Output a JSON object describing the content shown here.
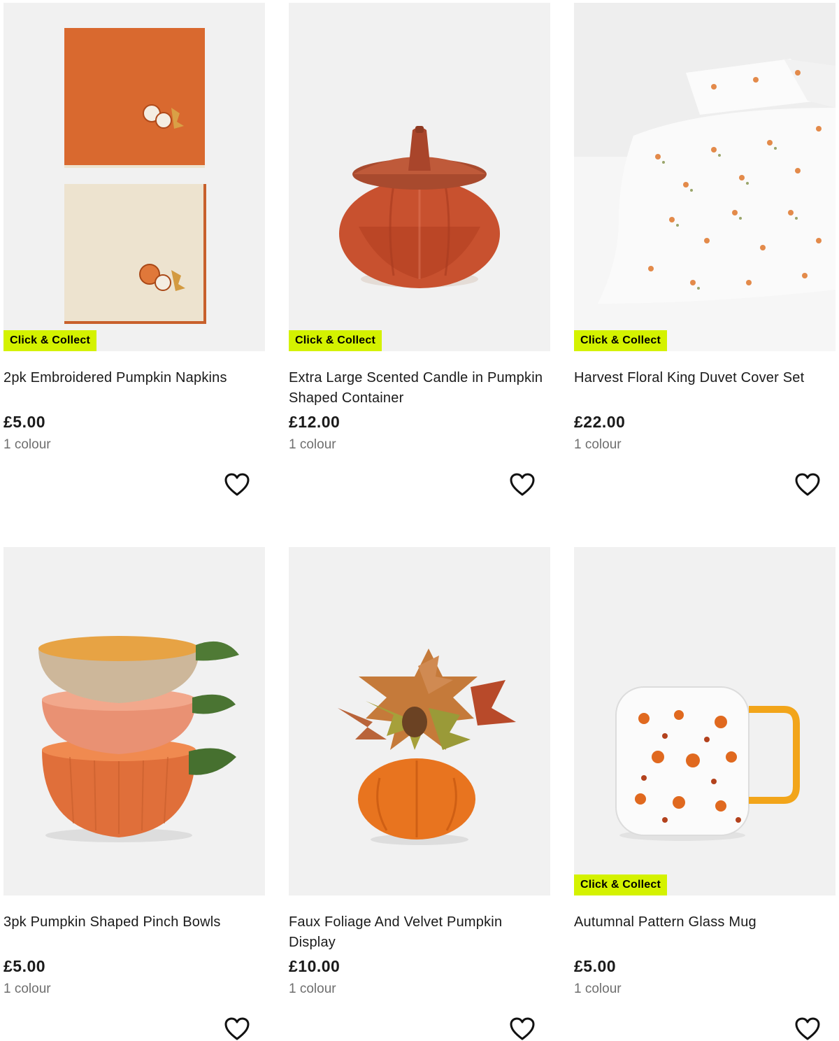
{
  "products": [
    {
      "name": "2pk Embroidered Pumpkin Napkins",
      "price": "£5.00",
      "colours": "1 colour",
      "badge": "Click & Collect",
      "image_icon": "napkins-image"
    },
    {
      "name": "Extra Large Scented Candle in Pumpkin Shaped Container",
      "price": "£12.00",
      "colours": "1 colour",
      "badge": "Click & Collect",
      "image_icon": "candle-image"
    },
    {
      "name": "Harvest Floral King Duvet Cover Set",
      "price": "£22.00",
      "colours": "1 colour",
      "badge": "Click & Collect",
      "image_icon": "duvet-image"
    },
    {
      "name": "3pk Pumpkin Shaped Pinch Bowls",
      "price": "£5.00",
      "colours": "1 colour",
      "badge": "",
      "image_icon": "bowls-image"
    },
    {
      "name": "Faux Foliage And Velvet Pumpkin Display",
      "price": "£10.00",
      "colours": "1 colour",
      "badge": "",
      "image_icon": "pumpkin-display-image"
    },
    {
      "name": "Autumnal Pattern Glass Mug",
      "price": "£5.00",
      "colours": "1 colour",
      "badge": "Click & Collect",
      "image_icon": "mug-image"
    }
  ],
  "colors": {
    "badge_bg": "#d4f200",
    "image_bg": "#f1f1f1",
    "muted_text": "#6e6e6e"
  },
  "icons": {
    "wishlist": "heart-outline-icon"
  }
}
